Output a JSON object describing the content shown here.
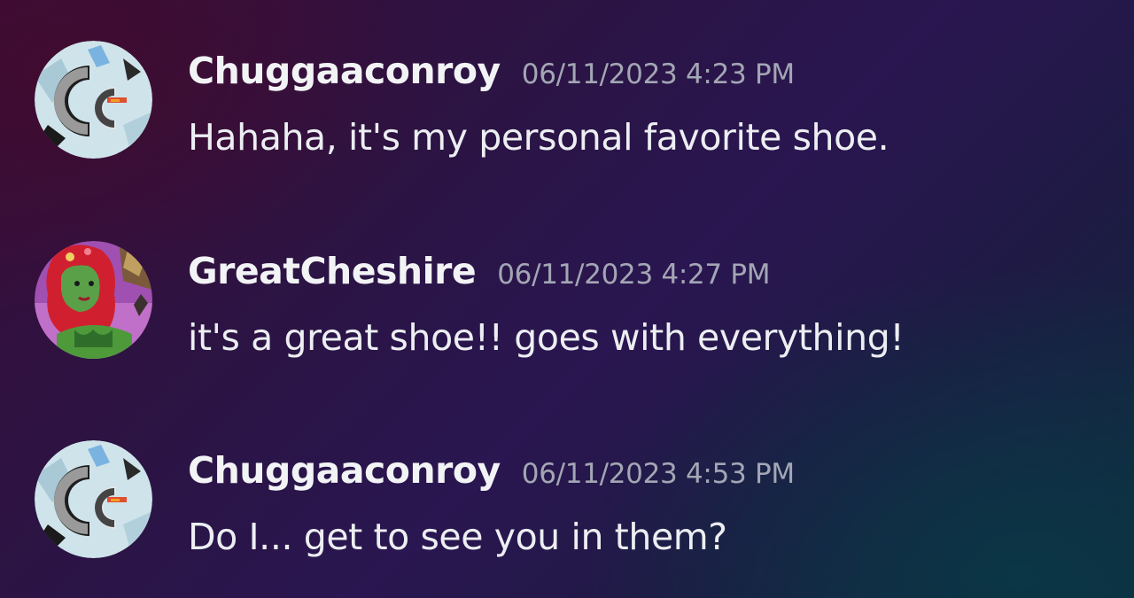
{
  "messages": [
    {
      "author": "Chuggaaconroy",
      "timestamp": "06/11/2023 4:23 PM",
      "content": "Hahaha, it's my personal favorite shoe.",
      "avatar_icon": "chuggaaconroy-cc-logo-avatar"
    },
    {
      "author": "GreatCheshire",
      "timestamp": "06/11/2023 4:27 PM",
      "content": "it's a great shoe!! goes with everything!",
      "avatar_icon": "poison-ivy-character-avatar"
    },
    {
      "author": "Chuggaaconroy",
      "timestamp": "06/11/2023 4:53 PM",
      "content": "Do I... get to see you in them?",
      "avatar_icon": "chuggaaconroy-cc-logo-avatar"
    }
  ],
  "colors": {
    "username": "#f2f3f5",
    "timestamp": "#a3a6b4",
    "message_text": "#eceef2",
    "background_start": "#3a0c38",
    "background_end": "#0f2a3c"
  }
}
